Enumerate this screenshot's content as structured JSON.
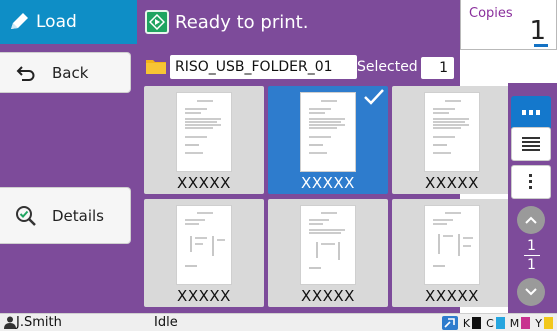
{
  "sidebar": {
    "title": "Load",
    "back_label": "Back",
    "details_label": "Details"
  },
  "header": {
    "status": "Ready to print.",
    "copies_label": "Copies",
    "copies_value": "1"
  },
  "folder": {
    "name": "RISO_USB_FOLDER_01",
    "selected_label": "Selected",
    "selected_count": "1"
  },
  "files": [
    {
      "label": "XXXXX",
      "selected": false
    },
    {
      "label": "XXXXX",
      "selected": true
    },
    {
      "label": "XXXXX",
      "selected": false
    },
    {
      "label": "XXXXX",
      "selected": false
    },
    {
      "label": "XXXXX",
      "selected": false
    },
    {
      "label": "XXXXX",
      "selected": false
    }
  ],
  "pager": {
    "current": "1",
    "total": "1"
  },
  "statusbar": {
    "user": "J.Smith",
    "state": "Idle",
    "inks": [
      {
        "label": "K",
        "color": "#111111"
      },
      {
        "label": "C",
        "color": "#27a6df"
      },
      {
        "label": "M",
        "color": "#c8328f"
      },
      {
        "label": "Y",
        "color": "#f2c81b"
      }
    ]
  },
  "colors": {
    "accent_purple": "#7d4b9a",
    "header_blue": "#0e8ec6",
    "selection_blue": "#2e7ccd",
    "ready_green": "#1fa460"
  }
}
